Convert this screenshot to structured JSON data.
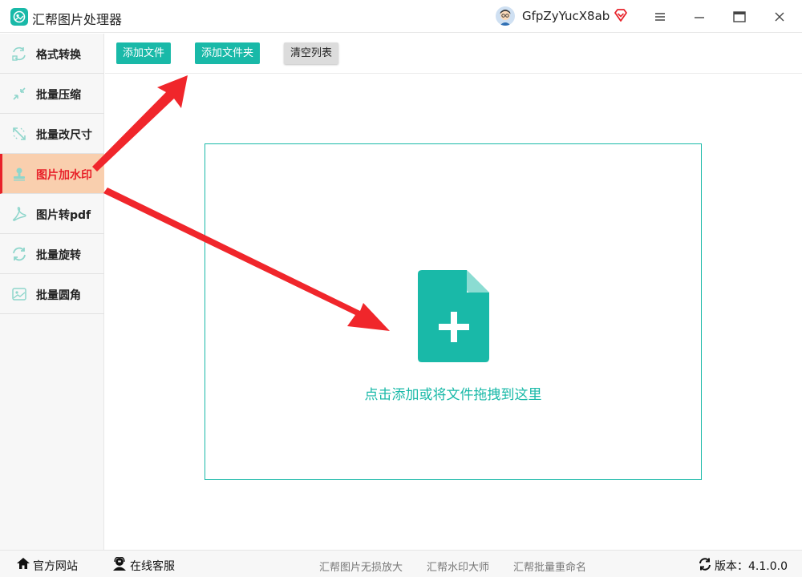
{
  "app": {
    "title": "汇帮图片处理器"
  },
  "user": {
    "name": "GfpZyYucX8ab"
  },
  "colors": {
    "accent": "#19b9a8",
    "active_bg": "#f9cfae",
    "active_text": "#e8222a",
    "arrow": "#f0262b"
  },
  "window_controls": [
    "menu-icon",
    "minimize-icon",
    "maximize-icon",
    "close-icon"
  ],
  "sidebar": {
    "items": [
      {
        "label": "格式转换",
        "icon": "format-convert-icon"
      },
      {
        "label": "批量压缩",
        "icon": "compress-icon"
      },
      {
        "label": "批量改尺寸",
        "icon": "resize-icon"
      },
      {
        "label": "图片加水印",
        "icon": "watermark-icon",
        "active": true
      },
      {
        "label": "图片转pdf",
        "icon": "pdf-icon"
      },
      {
        "label": "批量旋转",
        "icon": "rotate-icon"
      },
      {
        "label": "批量圆角",
        "icon": "rounded-corner-icon"
      }
    ]
  },
  "toolbar": {
    "add_file": "添加文件",
    "add_folder": "添加文件夹",
    "clear_list": "清空列表"
  },
  "dropzone": {
    "hint": "点击添加或将文件拖拽到这里",
    "icon": "add-file-icon"
  },
  "footer": {
    "website": "官方网站",
    "support": "在线客服",
    "links": [
      "汇帮图片无损放大",
      "汇帮水印大师",
      "汇帮批量重命名"
    ],
    "version": "版本：4.1.0.0"
  }
}
